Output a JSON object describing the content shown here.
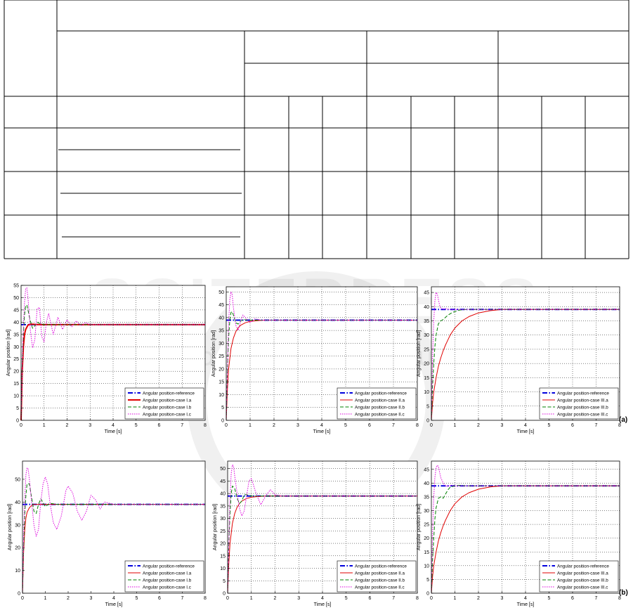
{
  "page": {
    "labels": {
      "a": "(a)",
      "b": "(b)"
    },
    "watermark": "SCITEPRESS · SCIENCE AND TECHNOLOGY PUBLICATIONS"
  },
  "table": {
    "rows": 6,
    "cols": 13,
    "note": "table cells are blank in the screenshot"
  },
  "colors": {
    "reference": "#0000dd",
    "a": "#e00000",
    "b": "#008000",
    "c": "#dd00dd"
  },
  "chart_data": [
    {
      "type": "line",
      "xlabel": "Time [s]",
      "ylabel": "Angular position [rad]",
      "xlim": [
        0,
        8
      ],
      "ylim": [
        0,
        55
      ],
      "xticks": [
        "0",
        "1",
        "2",
        "3",
        "4",
        "5",
        "6",
        "7",
        "8"
      ],
      "yticks": [
        "0",
        "5",
        "10",
        "15",
        "20",
        "25",
        "30",
        "35",
        "40",
        "45",
        "50",
        "55"
      ],
      "legend": {
        "position": "bottom-right"
      },
      "grid": true,
      "series": [
        {
          "name": "Angular position-reference",
          "style": "dashdot",
          "color": "#0000dd",
          "width": 2,
          "x": [
            0,
            8
          ],
          "y": [
            39,
            39
          ]
        },
        {
          "name": "Angular position-case I.a",
          "style": "solid",
          "color": "#e00000",
          "width": 2,
          "x": [
            0,
            0.05,
            0.1,
            0.15,
            0.2,
            0.3,
            0.4,
            0.5,
            0.6,
            0.8,
            1.0,
            1.5,
            8
          ],
          "y": [
            0,
            20,
            30,
            35,
            37,
            38.8,
            39.2,
            39.2,
            39.1,
            39,
            39,
            39,
            39
          ]
        },
        {
          "name": "Angular position-case I.b",
          "style": "dashed",
          "color": "#008000",
          "width": 1,
          "x": [
            0,
            0.05,
            0.1,
            0.15,
            0.2,
            0.25,
            0.3,
            0.4,
            0.5,
            0.6,
            0.7,
            0.8,
            1.0,
            1.2,
            1.5,
            8
          ],
          "y": [
            0,
            22,
            35,
            43,
            46.5,
            47,
            45,
            40.5,
            37.5,
            38.5,
            40,
            39.5,
            39,
            39,
            39,
            39
          ]
        },
        {
          "name": "Angular position-case I.c",
          "style": "dotted",
          "color": "#dd00dd",
          "width": 1,
          "x": [
            0,
            0.05,
            0.1,
            0.15,
            0.2,
            0.25,
            0.3,
            0.4,
            0.5,
            0.6,
            0.7,
            0.8,
            0.9,
            1.0,
            1.1,
            1.2,
            1.4,
            1.6,
            1.8,
            2.0,
            2.2,
            2.4,
            2.6,
            2.8,
            3.0,
            3.3,
            8
          ],
          "y": [
            0,
            22,
            38,
            48,
            53.5,
            54,
            50,
            37,
            29.5,
            33,
            45.5,
            46,
            34,
            32,
            40,
            43.5,
            35,
            42,
            37,
            41,
            38,
            40.5,
            38.5,
            39.8,
            39,
            39,
            39
          ]
        }
      ]
    },
    {
      "type": "line",
      "xlabel": "Time [s]",
      "ylabel": "Angular position [rad]",
      "xlim": [
        0,
        8
      ],
      "ylim": [
        0,
        52
      ],
      "xticks": [
        "0",
        "1",
        "2",
        "3",
        "4",
        "5",
        "6",
        "7",
        "8"
      ],
      "yticks": [
        "0",
        "5",
        "10",
        "15",
        "20",
        "25",
        "30",
        "35",
        "40",
        "45",
        "50"
      ],
      "legend": {
        "position": "bottom-right"
      },
      "grid": true,
      "series": [
        {
          "name": "Angular position-reference",
          "style": "dashdot",
          "color": "#0000dd",
          "width": 2,
          "x": [
            0,
            8
          ],
          "y": [
            39,
            39
          ]
        },
        {
          "name": "Angular position-case II.a",
          "style": "solid",
          "color": "#e00000",
          "width": 1,
          "x": [
            0,
            0.05,
            0.1,
            0.2,
            0.3,
            0.4,
            0.5,
            0.6,
            0.8,
            1.0,
            1.3,
            1.6,
            2.0,
            8
          ],
          "y": [
            0,
            12,
            20,
            28,
            32,
            34.5,
            36,
            37,
            38,
            38.5,
            38.8,
            39,
            39,
            39
          ]
        },
        {
          "name": "Angular position-case II.b",
          "style": "dashed",
          "color": "#008000",
          "width": 1,
          "x": [
            0,
            0.05,
            0.1,
            0.15,
            0.2,
            0.25,
            0.3,
            0.4,
            0.5,
            0.6,
            0.7,
            0.9,
            1.2,
            8
          ],
          "y": [
            0,
            20,
            32,
            39,
            42,
            42.3,
            41,
            38,
            37.5,
            38.5,
            39.3,
            39,
            39,
            39
          ]
        },
        {
          "name": "Angular position-case II.c",
          "style": "dotted",
          "color": "#dd00dd",
          "width": 1,
          "x": [
            0,
            0.05,
            0.1,
            0.15,
            0.2,
            0.25,
            0.3,
            0.4,
            0.5,
            0.6,
            0.7,
            0.8,
            1.0,
            1.2,
            1.5,
            8
          ],
          "y": [
            0,
            20,
            38,
            47,
            50,
            49,
            44,
            37,
            35,
            38.5,
            41,
            40,
            38,
            39.5,
            39,
            39
          ]
        }
      ]
    },
    {
      "type": "line",
      "xlabel": "Time [s]",
      "ylabel": "Angular position [rad]",
      "xlim": [
        0,
        8
      ],
      "ylim": [
        0,
        47
      ],
      "xticks": [
        "0",
        "1",
        "2",
        "3",
        "4",
        "5",
        "6",
        "7",
        "8"
      ],
      "yticks": [
        "0",
        "5",
        "10",
        "15",
        "20",
        "25",
        "30",
        "35",
        "40",
        "45"
      ],
      "legend": {
        "position": "bottom-right"
      },
      "grid": true,
      "series": [
        {
          "name": "Angular position-reference",
          "style": "dashdot",
          "color": "#0000dd",
          "width": 2,
          "x": [
            0,
            8
          ],
          "y": [
            39,
            39
          ]
        },
        {
          "name": "Angular position-case III.a",
          "style": "solid",
          "color": "#e00000",
          "width": 1,
          "x": [
            0,
            0.05,
            0.1,
            0.2,
            0.3,
            0.4,
            0.5,
            0.6,
            0.8,
            1.0,
            1.3,
            1.6,
            2.0,
            2.5,
            3.0,
            3.5,
            8
          ],
          "y": [
            0,
            6,
            10,
            15,
            19,
            22,
            24.5,
            26.5,
            30,
            32.5,
            35,
            36.5,
            37.8,
            38.6,
            39,
            39,
            39
          ]
        },
        {
          "name": "Angular position-case III.b",
          "style": "dashed",
          "color": "#008000",
          "width": 1,
          "x": [
            0,
            0.05,
            0.1,
            0.15,
            0.2,
            0.3,
            0.4,
            0.5,
            0.7,
            0.9,
            1.2,
            1.5,
            8
          ],
          "y": [
            0,
            12,
            20,
            26,
            30,
            34,
            35,
            35.5,
            37,
            38,
            38.8,
            39,
            39
          ]
        },
        {
          "name": "Angular position-case III.c",
          "style": "dotted",
          "color": "#dd00dd",
          "width": 1,
          "x": [
            0,
            0.05,
            0.1,
            0.15,
            0.2,
            0.25,
            0.3,
            0.35,
            0.4,
            0.5,
            0.6,
            0.8,
            1.0,
            8
          ],
          "y": [
            0,
            22,
            35,
            42,
            45,
            44.5,
            42.5,
            40.5,
            39.5,
            39,
            39.3,
            39,
            39,
            39
          ]
        }
      ]
    },
    {
      "type": "line",
      "xlabel": "Time [s]",
      "ylabel": "Angular position [rad]",
      "xlim": [
        0,
        8
      ],
      "ylim": [
        0,
        58
      ],
      "xticks": [
        "0",
        "1",
        "2",
        "3",
        "4",
        "5",
        "6",
        "7",
        "8"
      ],
      "yticks": [
        "0",
        "10",
        "20",
        "30",
        "40",
        "50"
      ],
      "legend": {
        "position": "bottom-right"
      },
      "grid": false,
      "series": [
        {
          "name": "Angular position-reference",
          "style": "dashdot",
          "color": "#0000dd",
          "width": 2,
          "x": [
            0,
            8
          ],
          "y": [
            39,
            39
          ]
        },
        {
          "name": "Angular position-case I.a",
          "style": "solid",
          "color": "#e00000",
          "width": 1,
          "x": [
            0,
            0.05,
            0.1,
            0.15,
            0.2,
            0.3,
            0.4,
            0.5,
            0.6,
            0.8,
            1.0,
            8
          ],
          "y": [
            0,
            18,
            28,
            33,
            35.5,
            37.5,
            38.5,
            39,
            39,
            39,
            39,
            39
          ]
        },
        {
          "name": "Angular position-case I.b",
          "style": "dashed",
          "color": "#008000",
          "width": 1,
          "x": [
            0,
            0.05,
            0.1,
            0.15,
            0.2,
            0.3,
            0.4,
            0.5,
            0.6,
            0.7,
            0.8,
            1.0,
            1.2,
            1.5,
            8
          ],
          "y": [
            0,
            20,
            35,
            43,
            48,
            48,
            42,
            36,
            35,
            39,
            41.5,
            38,
            39.5,
            39,
            39
          ]
        },
        {
          "name": "Angular position-case I.c",
          "style": "dotted",
          "color": "#dd00dd",
          "width": 1,
          "x": [
            0,
            0.05,
            0.1,
            0.15,
            0.2,
            0.25,
            0.3,
            0.4,
            0.5,
            0.6,
            0.7,
            0.8,
            0.9,
            1.0,
            1.1,
            1.2,
            1.35,
            1.5,
            1.7,
            1.9,
            2.0,
            2.2,
            2.4,
            2.6,
            2.8,
            3.0,
            3.2,
            3.4,
            3.6,
            3.8,
            4.0,
            8
          ],
          "y": [
            0,
            25,
            42,
            52,
            55,
            54.5,
            50,
            40,
            30,
            25,
            28,
            40,
            48,
            51,
            48,
            40,
            31,
            28,
            34,
            45,
            47,
            44,
            36,
            32,
            36,
            43,
            41,
            37,
            40,
            39.5,
            39,
            39
          ]
        }
      ]
    },
    {
      "type": "line",
      "xlabel": "Time [s]",
      "ylabel": "Angular position [rad]",
      "xlim": [
        0,
        8
      ],
      "ylim": [
        0,
        53
      ],
      "xticks": [
        "0",
        "1",
        "2",
        "3",
        "4",
        "5",
        "6",
        "7",
        "8"
      ],
      "yticks": [
        "0",
        "5",
        "10",
        "15",
        "20",
        "25",
        "30",
        "35",
        "40",
        "45",
        "50"
      ],
      "legend": {
        "position": "bottom-right"
      },
      "grid": true,
      "series": [
        {
          "name": "Angular position-reference",
          "style": "dashdot",
          "color": "#0000dd",
          "width": 2,
          "x": [
            0,
            8
          ],
          "y": [
            39,
            39
          ]
        },
        {
          "name": "Angular position-case II.a",
          "style": "solid",
          "color": "#e00000",
          "width": 1,
          "x": [
            0,
            0.05,
            0.1,
            0.2,
            0.3,
            0.4,
            0.5,
            0.6,
            0.8,
            1.0,
            1.3,
            1.6,
            2.0,
            8
          ],
          "y": [
            0,
            12,
            20,
            28,
            32,
            34.5,
            36,
            37,
            38,
            38.5,
            38.8,
            39,
            39,
            39
          ]
        },
        {
          "name": "Angular position-case II.b",
          "style": "dashed",
          "color": "#008000",
          "width": 1,
          "x": [
            0,
            0.05,
            0.1,
            0.15,
            0.2,
            0.3,
            0.4,
            0.5,
            0.6,
            0.7,
            0.8,
            1.0,
            1.2,
            8
          ],
          "y": [
            0,
            20,
            32,
            40,
            43,
            42,
            38,
            36,
            37,
            39.5,
            39.5,
            39,
            39,
            39
          ]
        },
        {
          "name": "Angular position-case II.c",
          "style": "dotted",
          "color": "#dd00dd",
          "width": 1,
          "x": [
            0,
            0.05,
            0.1,
            0.15,
            0.2,
            0.25,
            0.3,
            0.4,
            0.5,
            0.6,
            0.7,
            0.8,
            0.9,
            1.0,
            1.2,
            1.4,
            1.6,
            1.8,
            2.0,
            2.3,
            8
          ],
          "y": [
            0,
            20,
            38,
            48,
            51.5,
            51,
            47,
            40,
            34,
            31,
            33,
            39,
            45,
            46,
            40,
            35.5,
            39,
            41.5,
            39.5,
            39,
            39
          ]
        }
      ]
    },
    {
      "type": "line",
      "xlabel": "Time [s]",
      "ylabel": "Angular position [rad]",
      "xlim": [
        0,
        8
      ],
      "ylim": [
        0,
        48
      ],
      "xticks": [
        "0",
        "1",
        "2",
        "3",
        "4",
        "5",
        "6",
        "7",
        "8"
      ],
      "yticks": [
        "0",
        "5",
        "10",
        "15",
        "20",
        "25",
        "30",
        "35",
        "40",
        "45"
      ],
      "legend": {
        "position": "bottom-right"
      },
      "grid": true,
      "series": [
        {
          "name": "Angular position-reference",
          "style": "dashdot",
          "color": "#0000dd",
          "width": 2,
          "x": [
            0,
            8
          ],
          "y": [
            39,
            39
          ]
        },
        {
          "name": "Angular position-case III.a",
          "style": "solid",
          "color": "#e00000",
          "width": 1,
          "x": [
            0,
            0.05,
            0.1,
            0.2,
            0.3,
            0.4,
            0.5,
            0.6,
            0.8,
            1.0,
            1.3,
            1.6,
            2.0,
            2.5,
            3.0,
            3.5,
            8
          ],
          "y": [
            0,
            6,
            10,
            15,
            19,
            22,
            24.5,
            26.5,
            30,
            32.5,
            35,
            36.5,
            37.8,
            38.6,
            39,
            39,
            39
          ]
        },
        {
          "name": "Angular position-case III.b",
          "style": "dashed",
          "color": "#008000",
          "width": 1,
          "x": [
            0,
            0.05,
            0.1,
            0.15,
            0.2,
            0.3,
            0.4,
            0.5,
            0.6,
            0.7,
            0.8,
            1.0,
            1.2,
            1.5,
            8
          ],
          "y": [
            0,
            12,
            20,
            27,
            31,
            34.5,
            35,
            34.5,
            36,
            37.5,
            38.5,
            39,
            39.2,
            39,
            39
          ]
        },
        {
          "name": "Angular position-case III.c",
          "style": "dotted",
          "color": "#dd00dd",
          "width": 1,
          "x": [
            0,
            0.05,
            0.1,
            0.15,
            0.2,
            0.25,
            0.3,
            0.35,
            0.4,
            0.5,
            0.6,
            0.7,
            0.8,
            1.0,
            1.2,
            8
          ],
          "y": [
            0,
            22,
            35,
            42,
            45.5,
            46.5,
            46,
            44,
            42,
            40,
            39,
            38.8,
            39.2,
            39,
            39,
            39
          ]
        }
      ]
    }
  ]
}
